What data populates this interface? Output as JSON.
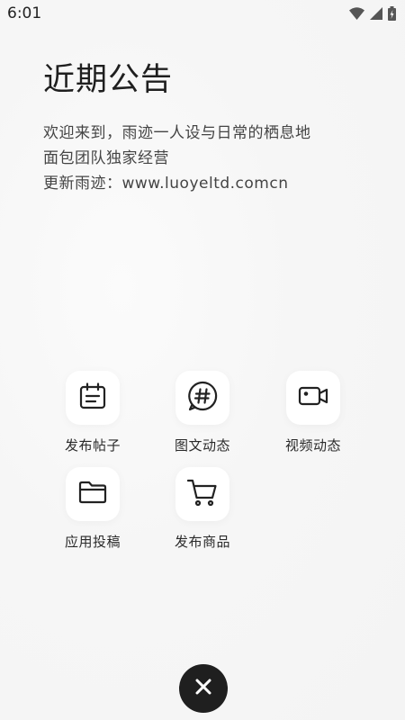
{
  "status_bar": {
    "time": "6:01"
  },
  "announcement": {
    "title": "近期公告",
    "lines": [
      "欢迎来到，雨迹一人设与日常的栖息地",
      "面包团队独家经营",
      "更新雨迹：www.luoyeltd.comcn"
    ]
  },
  "actions": [
    {
      "label": "发布帖子",
      "icon": "calendar-icon"
    },
    {
      "label": "图文动态",
      "icon": "hashtag-bubble-icon"
    },
    {
      "label": "视频动态",
      "icon": "video-camera-icon"
    },
    {
      "label": "应用投稿",
      "icon": "folder-icon"
    },
    {
      "label": "发布商品",
      "icon": "shopping-cart-icon"
    }
  ],
  "close_button": {
    "icon": "close-icon"
  }
}
